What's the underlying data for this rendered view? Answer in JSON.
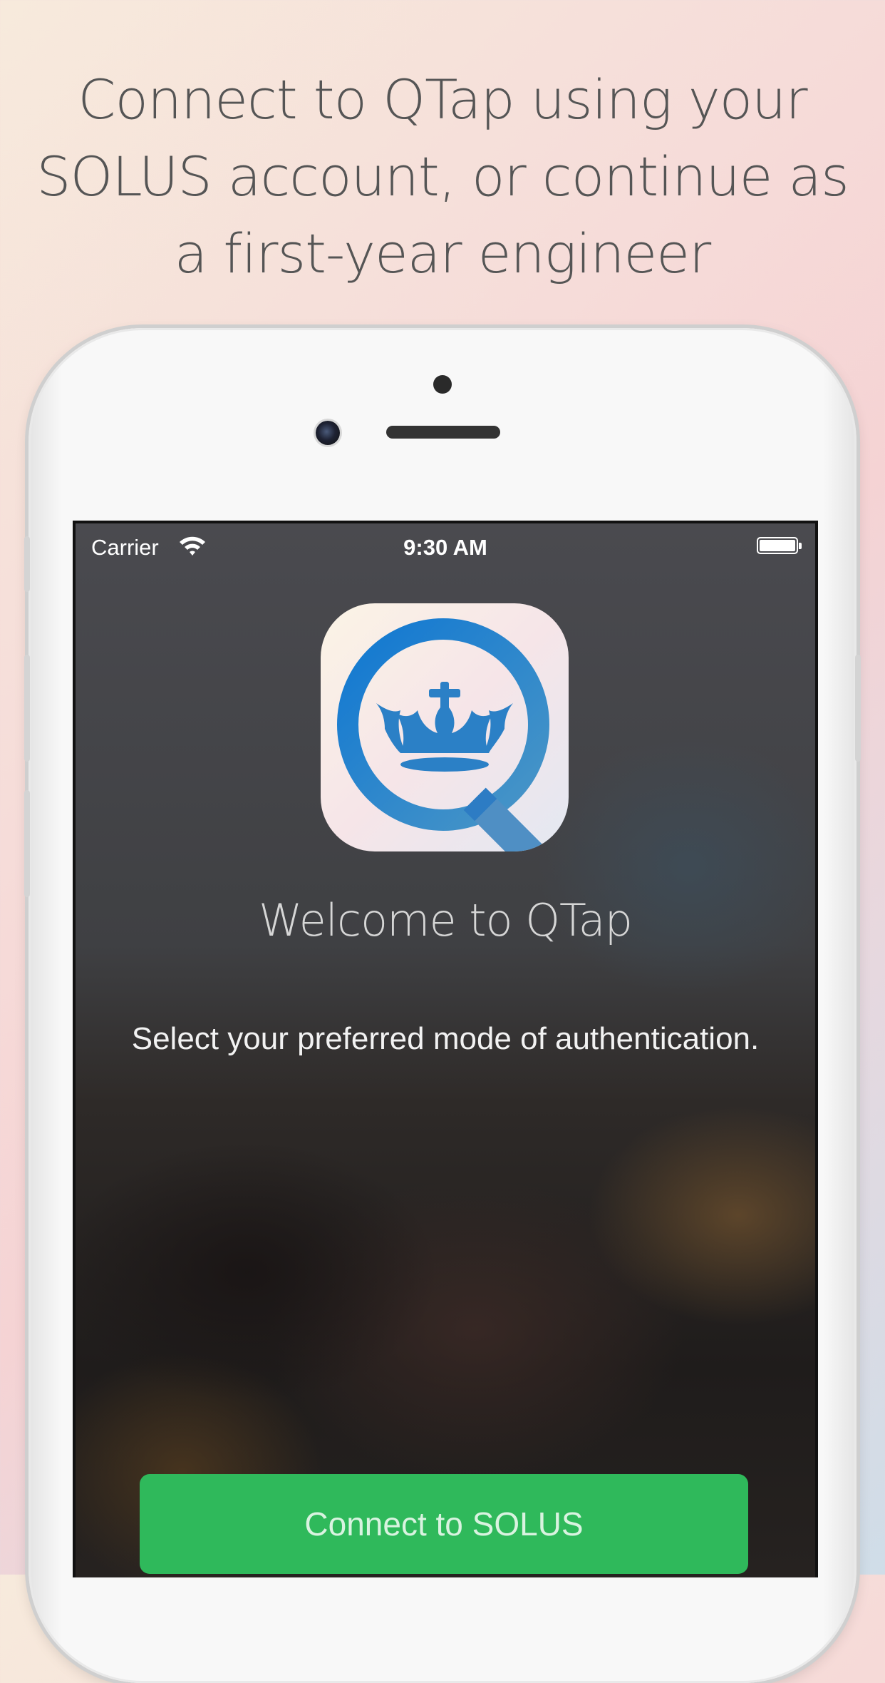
{
  "headline": {
    "lines": [
      "Connect to QTap using your",
      "SOLUS account, or continue as",
      "a first-year engineer"
    ]
  },
  "status_bar": {
    "carrier": "Carrier",
    "time": "9:30 AM",
    "icons": [
      "wifi-icon",
      "battery-icon"
    ]
  },
  "app": {
    "icon": "qtap-magnifier-crown-logo",
    "welcome": "Welcome to QTap",
    "instruction": "Select your preferred mode of authentication.",
    "primary_button": "Connect to SOLUS"
  },
  "colors": {
    "accent_green": "#2fb95b",
    "logo_blue": "#1a7fd0",
    "headline_text": "#555555"
  }
}
